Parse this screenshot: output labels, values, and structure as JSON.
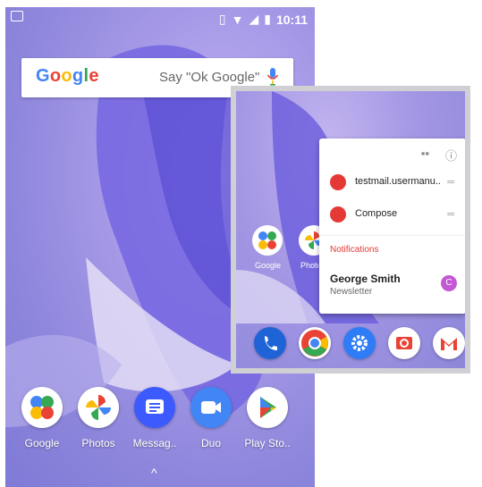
{
  "status_bar": {
    "time": "10:11"
  },
  "search": {
    "logo": "Google",
    "hint": "Say \"Ok Google\""
  },
  "dock": {
    "apps": [
      {
        "label": "Google",
        "icon": "google-folder-icon"
      },
      {
        "label": "Photos",
        "icon": "photos-icon"
      },
      {
        "label": "Messag..",
        "icon": "messages-icon"
      },
      {
        "label": "Duo",
        "icon": "duo-icon"
      },
      {
        "label": "Play Sto..",
        "icon": "play-store-icon"
      }
    ],
    "chevron": "^"
  },
  "inset": {
    "folder_label": "Google",
    "partial_label": "Photos",
    "popup": {
      "shortcut_1": "testmail.usermanu..",
      "shortcut_2": "Compose",
      "notifications_header": "Notifications",
      "notification_title": "George Smith",
      "notification_subtitle": "Newsletter",
      "notification_avatar": "C"
    },
    "dock_icons": [
      "phone-icon",
      "chrome-icon",
      "settings-icon",
      "camera-icon",
      "gmail-icon"
    ]
  },
  "colors": {
    "google_blue": "#4285F4",
    "google_red": "#EA4335",
    "google_yellow": "#FBBC05",
    "google_green": "#34A853",
    "accent_red": "#e53935"
  }
}
